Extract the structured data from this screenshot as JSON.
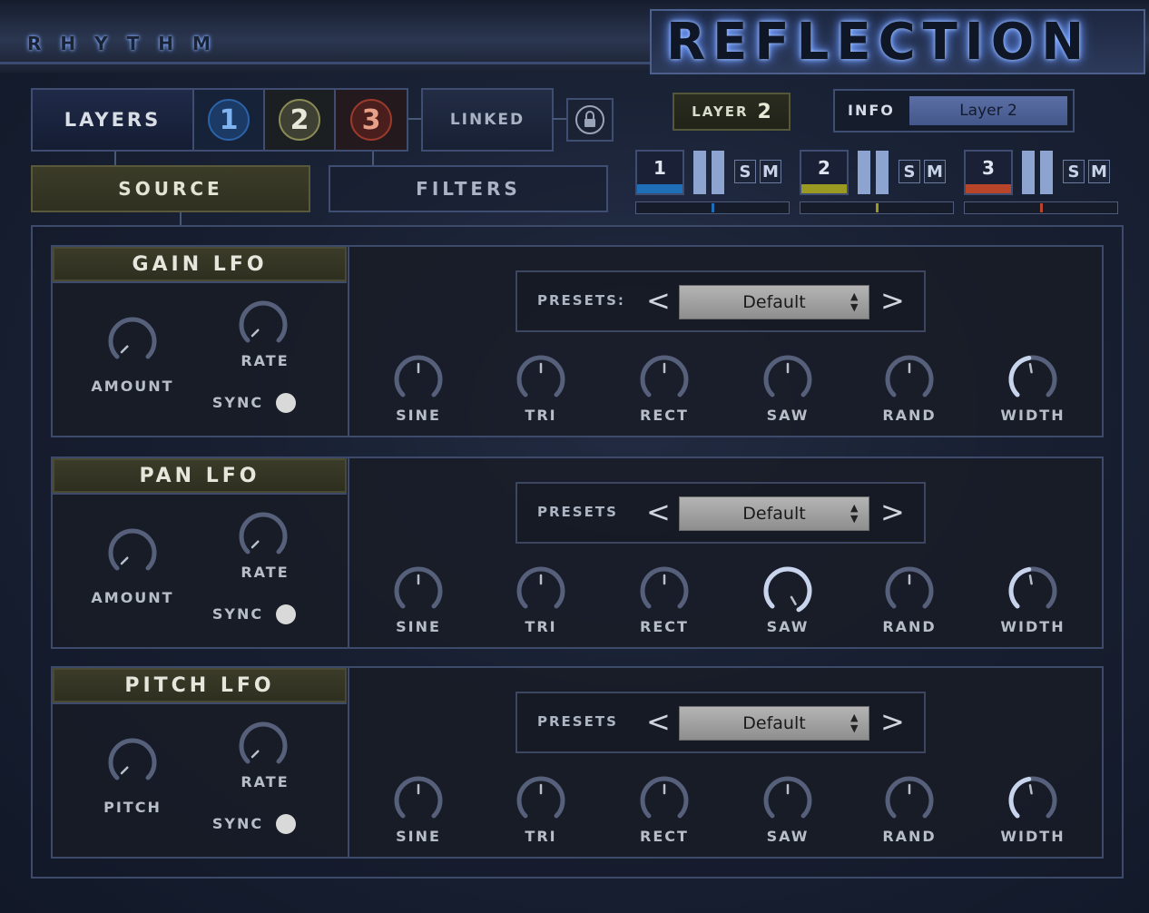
{
  "header": {
    "brand": "RHYTHM",
    "product": "REFLECTION"
  },
  "layers_bar": {
    "layers_label": "LAYERS",
    "layer_buttons": [
      "1",
      "2",
      "3"
    ],
    "linked_label": "LINKED"
  },
  "tabs": {
    "source": "SOURCE",
    "filters": "FILTERS"
  },
  "layer_indicator": {
    "label": "LAYER",
    "value": "2"
  },
  "info": {
    "label": "INFO",
    "value": "Layer 2"
  },
  "mixer": [
    {
      "num": "1",
      "solo": "S",
      "mute": "M",
      "color": "#1e6fb8"
    },
    {
      "num": "2",
      "solo": "S",
      "mute": "M",
      "color": "#9a9a22"
    },
    {
      "num": "3",
      "solo": "S",
      "mute": "M",
      "color": "#b8442a"
    }
  ],
  "lfo_panels": [
    {
      "title": "GAIN LFO",
      "left_knob": "AMOUNT",
      "rate": "RATE",
      "sync": "SYNC",
      "presets_label": "PRESETS:",
      "preset_value": "Default",
      "shapes": [
        "SINE",
        "TRI",
        "RECT",
        "SAW",
        "RAND",
        "WIDTH"
      ]
    },
    {
      "title": "PAN LFO",
      "left_knob": "AMOUNT",
      "rate": "RATE",
      "sync": "SYNC",
      "presets_label": "PRESETS",
      "preset_value": "Default",
      "shapes": [
        "SINE",
        "TRI",
        "RECT",
        "SAW",
        "RAND",
        "WIDTH"
      ]
    },
    {
      "title": "PITCH LFO",
      "left_knob": "PITCH",
      "rate": "RATE",
      "sync": "SYNC",
      "presets_label": "PRESETS",
      "preset_value": "Default",
      "shapes": [
        "SINE",
        "TRI",
        "RECT",
        "SAW",
        "RAND",
        "WIDTH"
      ]
    }
  ],
  "controls": {
    "prev": "<",
    "next": ">",
    "select_arrows": "▲▼"
  }
}
